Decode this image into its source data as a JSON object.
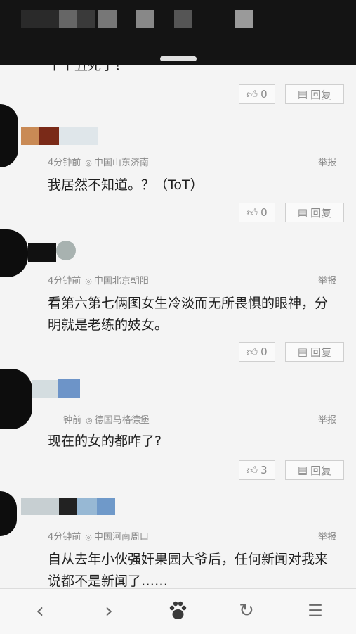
{
  "partial_comment_text": "个个丑死了！",
  "comments": [
    {
      "meta_time": "4分钟前",
      "location": "中国山东济南",
      "report": "举报",
      "text": "我居然不知道。？（ToT）",
      "likes": "0",
      "reply": "回复"
    },
    {
      "meta_time": "4分钟前",
      "location": "中国北京朝阳",
      "report": "举报",
      "text": "看第六第七俩图女生冷淡而无所畏惧的眼神，分明就是老练的妓女。",
      "likes": "0",
      "reply": "回复"
    },
    {
      "meta_time": "钟前",
      "location": "德国马格德堡",
      "report": "举报",
      "text": "现在的女的都咋了?",
      "likes": "3",
      "reply": "回复"
    },
    {
      "meta_time": "4分钟前",
      "location": "中国河南周口",
      "report": "举报",
      "text": "自从去年小伙强奸果园大爷后，任何新闻对我来说都不是新闻了……",
      "likes": "",
      "reply": ""
    }
  ],
  "first_actions": {
    "likes": "0",
    "reply": "回复"
  },
  "icons": {
    "like": "thumbs-up-icon",
    "reply": "comment-icon",
    "back": "back-arrow-icon",
    "forward": "forward-arrow-icon",
    "home": "baidu-paw-icon",
    "refresh": "refresh-icon",
    "menu": "menu-icon"
  },
  "colors": {
    "background": "#f4f4f4",
    "status_bar": "#141414",
    "text": "#1f1f1f",
    "meta": "#8a8a8a"
  }
}
